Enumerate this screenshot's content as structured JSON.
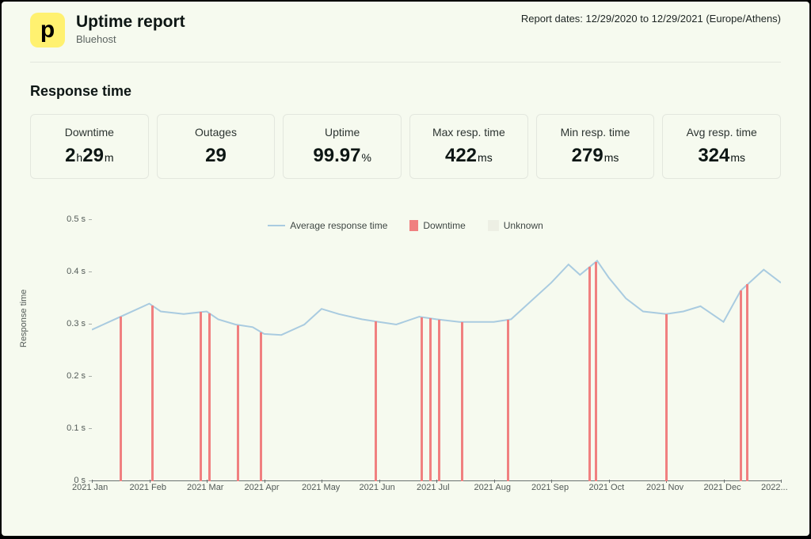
{
  "header": {
    "logo_letter": "p",
    "title": "Uptime report",
    "subtitle": "Bluehost",
    "report_dates": "Report dates: 12/29/2020 to 12/29/2021 (Europe/Athens)"
  },
  "section_title": "Response time",
  "cards": {
    "downtime": {
      "label": "Downtime",
      "value_h": "2",
      "unit_h": "h",
      "value_m": "29",
      "unit_m": "m"
    },
    "outages": {
      "label": "Outages",
      "value": "29"
    },
    "uptime": {
      "label": "Uptime",
      "value": "99.97",
      "unit": "%"
    },
    "max": {
      "label": "Max resp. time",
      "value": "422",
      "unit": "ms"
    },
    "min": {
      "label": "Min resp. time",
      "value": "279",
      "unit": "ms"
    },
    "avg": {
      "label": "Avg resp. time",
      "value": "324",
      "unit": "ms"
    }
  },
  "y_ticks": [
    "0 s",
    "0.1 s",
    "0.2 s",
    "0.3 s",
    "0.4 s",
    "0.5 s"
  ],
  "y_axis_label": "Response time",
  "x_ticks": [
    "2021 Jan",
    "2021 Feb",
    "2021 Mar",
    "2021 Apr",
    "2021 May",
    "2021 Jun",
    "2021 Jul",
    "2021 Aug",
    "2021 Sep",
    "2021 Oct",
    "2021 Nov",
    "2021 Dec",
    "2022..."
  ],
  "legend": {
    "avg": "Average response time",
    "down": "Downtime",
    "unknown": "Unknown"
  },
  "chart_data": {
    "type": "line",
    "title": "Response time",
    "xlabel": "",
    "ylabel": "Response time",
    "ylim": [
      0,
      0.5
    ],
    "x_categories": [
      "2021 Jan",
      "2021 Feb",
      "2021 Mar",
      "2021 Apr",
      "2021 May",
      "2021 Jun",
      "2021 Jul",
      "2021 Aug",
      "2021 Sep",
      "2021 Oct",
      "2021 Nov",
      "2021 Dec",
      "2022..."
    ],
    "series": [
      {
        "name": "Average response time",
        "x": [
          0,
          0.3,
          0.6,
          1.0,
          1.2,
          1.6,
          2.0,
          2.2,
          2.5,
          2.8,
          3.0,
          3.3,
          3.7,
          4.0,
          4.3,
          4.7,
          5.0,
          5.3,
          5.7,
          6.0,
          6.4,
          7.0,
          7.3,
          7.6,
          8.0,
          8.3,
          8.5,
          8.8,
          9.0,
          9.3,
          9.6,
          10.0,
          10.3,
          10.6,
          11.0,
          11.3,
          11.7,
          12.0
        ],
        "values": [
          0.29,
          0.305,
          0.32,
          0.34,
          0.325,
          0.32,
          0.325,
          0.31,
          0.3,
          0.295,
          0.282,
          0.28,
          0.3,
          0.33,
          0.32,
          0.31,
          0.305,
          0.3,
          0.315,
          0.31,
          0.305,
          0.305,
          0.31,
          0.34,
          0.38,
          0.415,
          0.395,
          0.422,
          0.39,
          0.35,
          0.325,
          0.32,
          0.325,
          0.335,
          0.305,
          0.365,
          0.405,
          0.38
        ]
      }
    ],
    "downtime_events_x": [
      0.5,
      1.05,
      1.9,
      2.05,
      2.55,
      2.95,
      4.95,
      5.75,
      5.9,
      6.05,
      6.45,
      7.25,
      8.67,
      8.78,
      10.0,
      11.3,
      11.42
    ]
  }
}
